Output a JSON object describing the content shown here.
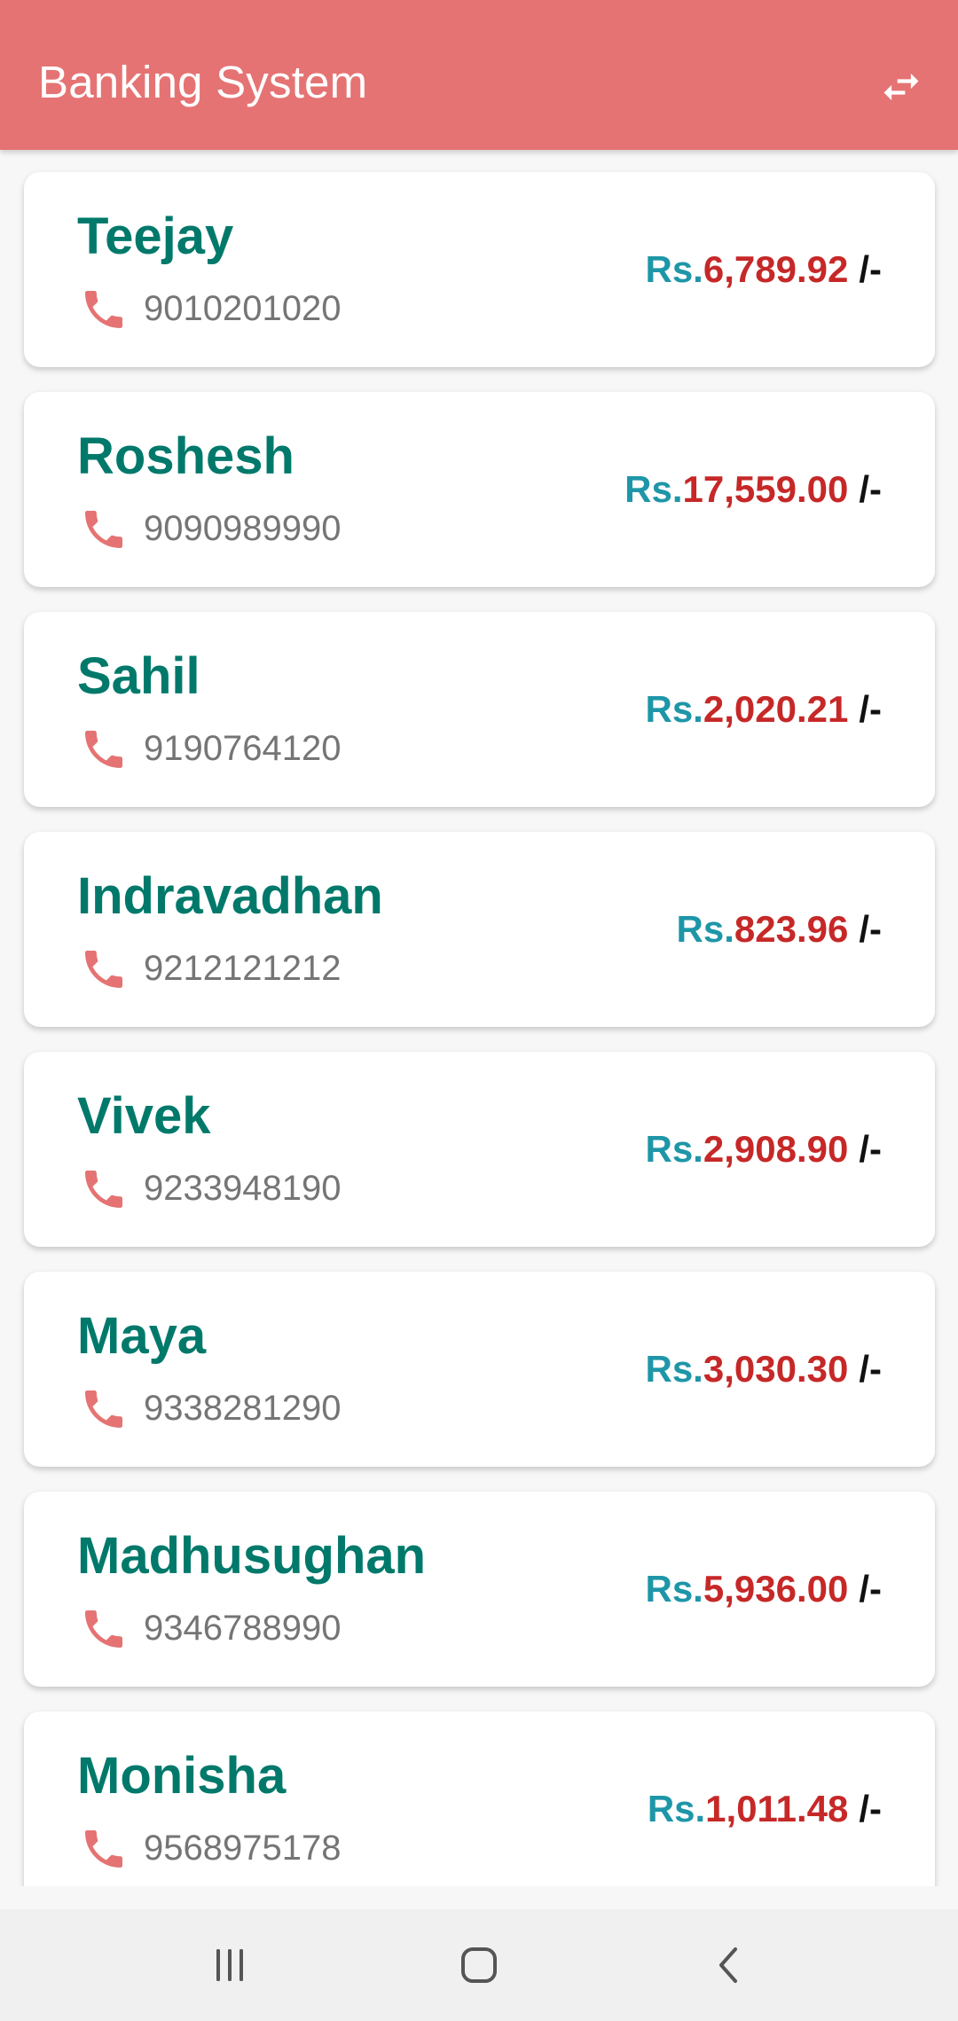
{
  "app": {
    "title": "Banking System",
    "header_color": "#e57373",
    "action_icon": "swap-horiz-icon"
  },
  "currency": {
    "prefix": "Rs.",
    "suffix": "/-"
  },
  "customers": [
    {
      "name": "Teejay",
      "phone": "9010201020",
      "amount": "6,789.92"
    },
    {
      "name": "Roshesh",
      "phone": "9090989990",
      "amount": "17,559.00"
    },
    {
      "name": "Sahil",
      "phone": "9190764120",
      "amount": "2,020.21"
    },
    {
      "name": "Indravadhan",
      "phone": "9212121212",
      "amount": "823.96"
    },
    {
      "name": "Vivek",
      "phone": "9233948190",
      "amount": "2,908.90"
    },
    {
      "name": "Maya",
      "phone": "9338281290",
      "amount": "3,030.30"
    },
    {
      "name": "Madhusughan",
      "phone": "9346788990",
      "amount": "5,936.00"
    },
    {
      "name": "Monisha",
      "phone": "9568975178",
      "amount": "1,011.48"
    }
  ],
  "colors": {
    "name": "#00796b",
    "phone_text": "#757575",
    "phone_icon": "#e57373",
    "amount_prefix": "#1e96a8",
    "amount_value": "#c62828"
  },
  "system_nav": {
    "icons": [
      "recent-apps-icon",
      "home-icon",
      "back-icon"
    ]
  }
}
